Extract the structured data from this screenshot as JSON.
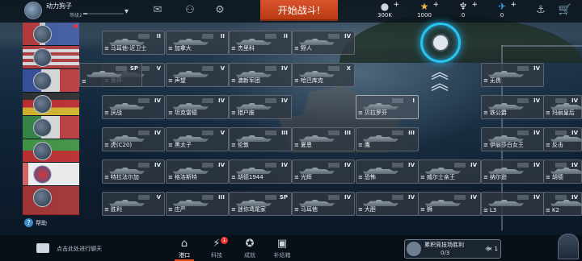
{
  "player": {
    "name": "动力狗子",
    "level_label": "等级2",
    "exp_fraction": 0.1
  },
  "topbar": {
    "battle_label": "开始战斗!",
    "resources": [
      {
        "icon": "silver-coins-icon",
        "value": "300K"
      },
      {
        "icon": "gold-star-icon",
        "value": "1000"
      },
      {
        "icon": "blueprint-icon",
        "value": "0"
      },
      {
        "icon": "research-icon",
        "value": "0"
      }
    ],
    "icons": [
      "mail-icon",
      "friends-icon",
      "settings-icon",
      "shop-cart-icon"
    ]
  },
  "nations": [
    "nation-1",
    "nation-2",
    "nation-3",
    "nation-4",
    "nation-5",
    "nation-6",
    "nation-7",
    "nation-8"
  ],
  "help_label": "帮助",
  "ships": [
    {
      "name": "马耳他-近卫士",
      "tier": "II"
    },
    {
      "name": "加拿大",
      "tier": "II"
    },
    {
      "name": "杰里科",
      "tier": "II"
    },
    {
      "name": "野人",
      "tier": "IV"
    },
    {
      "name": "鲁莽",
      "tier": "V"
    },
    {
      "name": "声望",
      "tier": "V"
    },
    {
      "name": "澳新军团",
      "tier": "IV"
    },
    {
      "name": "哈巴库克",
      "tier": "X"
    },
    {
      "name": "无畏",
      "tier": "IV"
    },
    {
      "name": "厌战",
      "tier": "IV"
    },
    {
      "name": "坦克雷德",
      "tier": "IV"
    },
    {
      "name": "猎户座",
      "tier": "IV"
    },
    {
      "name": "贝拉罗芬",
      "tier": "I"
    },
    {
      "name": "铁公爵",
      "tier": "IV"
    },
    {
      "name": "玛丽皇后",
      "tier": "IV"
    },
    {
      "name": "虎(C20)",
      "tier": "IV"
    },
    {
      "name": "黑太子",
      "tier": "V"
    },
    {
      "name": "伦敦",
      "tier": "III"
    },
    {
      "name": "夏恩",
      "tier": "III"
    },
    {
      "name": "鹰",
      "tier": "III"
    },
    {
      "name": "伊丽莎白女王",
      "tier": "IV"
    },
    {
      "name": "反击",
      "tier": "IV"
    },
    {
      "name": "特拉法尔加",
      "tier": "IV"
    },
    {
      "name": "格洛斯特",
      "tier": "IV"
    },
    {
      "name": "胡德1944",
      "tier": "IV"
    },
    {
      "name": "光辉",
      "tier": "IV"
    },
    {
      "name": "恐怖",
      "tier": "IV"
    },
    {
      "name": "威尔士亲王",
      "tier": "IV"
    },
    {
      "name": "纳尔逊",
      "tier": "IV"
    },
    {
      "name": "胡德",
      "tier": "IV"
    },
    {
      "name": "胜利",
      "tier": "V"
    },
    {
      "name": "庄严",
      "tier": "III"
    },
    {
      "name": "迷你鸢尾家",
      "tier": "SP"
    },
    {
      "name": "马耳他",
      "tier": "IV"
    },
    {
      "name": "大胆",
      "tier": "IV"
    },
    {
      "name": "狮",
      "tier": "IV"
    },
    {
      "name": "L3",
      "tier": "IV"
    },
    {
      "name": "K2",
      "tier": "IV"
    },
    {
      "name": "",
      "tier": "SP"
    }
  ],
  "bottom": {
    "chat_label": "点击此处进行聊天",
    "nav": [
      {
        "label": "港口",
        "icon": "port-icon",
        "active": true
      },
      {
        "label": "科技",
        "icon": "tech-icon",
        "badge": "1"
      },
      {
        "label": "成就",
        "icon": "achievement-icon"
      },
      {
        "label": "补给箱",
        "icon": "supply-box-icon"
      }
    ],
    "arena": {
      "title": "累积竞技场胜利",
      "progress": "0/3",
      "reward_count": "× 1"
    }
  }
}
